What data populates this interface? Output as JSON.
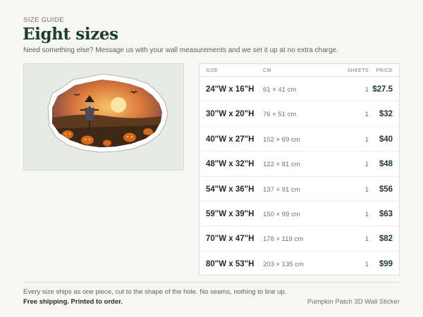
{
  "header": {
    "eyebrow": "SIZE GUIDE",
    "title": "Eight sizes",
    "subtitle": "Need something else? Message us with your wall measurements and we set it up at no extra charge."
  },
  "preview": {
    "image": "pumpkin-patch-scarecrow-sticker"
  },
  "table": {
    "headers": {
      "size": "SIZE",
      "cm": "CM",
      "sheets": "SHEETS",
      "price": "PRICE"
    },
    "rows": [
      {
        "size": "24\"W x 16\"H",
        "cm": "61 × 41 cm",
        "sheets": "1",
        "price": "$27.5"
      },
      {
        "size": "30\"W x 20\"H",
        "cm": "76 × 51 cm",
        "sheets": "1",
        "price": "$32"
      },
      {
        "size": "40\"W x 27\"H",
        "cm": "102 × 69 cm",
        "sheets": "1",
        "price": "$40"
      },
      {
        "size": "48\"W x 32\"H",
        "cm": "122 × 81 cm",
        "sheets": "1",
        "price": "$48"
      },
      {
        "size": "54\"W x 36\"H",
        "cm": "137 × 91 cm",
        "sheets": "1",
        "price": "$56"
      },
      {
        "size": "59\"W x 39\"H",
        "cm": "150 × 99 cm",
        "sheets": "1",
        "price": "$63"
      },
      {
        "size": "70\"W x 47\"H",
        "cm": "178 × 119 cm",
        "sheets": "1",
        "price": "$82"
      },
      {
        "size": "80\"W x 53\"H",
        "cm": "203 × 135 cm",
        "sheets": "1",
        "price": "$99"
      }
    ]
  },
  "footer": {
    "note": "Every size ships as one piece, cut to the shape of the hole. No seams, nothing to line up.",
    "shipping": "Free shipping. Printed to order.",
    "product": "Pumpkin Patch 3D Wall Sticker"
  },
  "colors": {
    "accent": "#1d3b2e",
    "background": "#f6f6f4"
  }
}
